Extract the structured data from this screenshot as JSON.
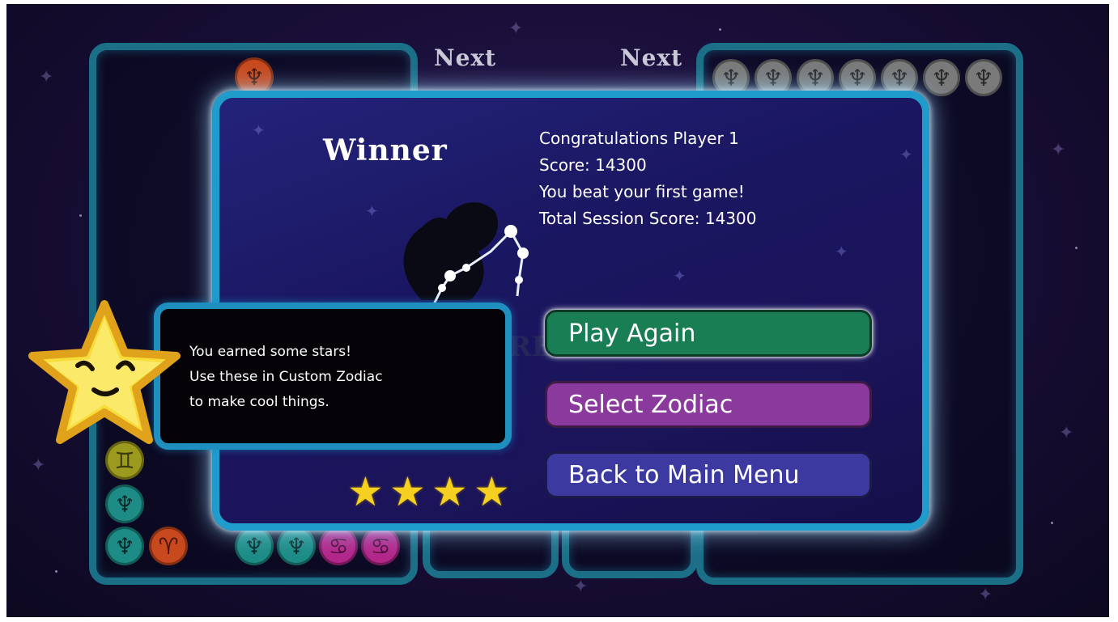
{
  "next_labels": [
    "Next",
    "Next"
  ],
  "dialog": {
    "title": "Winner",
    "lines": [
      "Congratulations Player 1",
      "Score: 14300",
      "You beat your first game!",
      "Total Session Score: 14300"
    ],
    "background_text": "NEW HIGH SCORE!",
    "buttons": {
      "play_again": "Play Again",
      "select_zodiac": "Select Zodiac",
      "main_menu": "Back to Main Menu"
    },
    "stars_earned": 4,
    "accent_color": "#1f9ccc"
  },
  "tooltip": {
    "lines": [
      "You earned some stars!",
      "Use these in Custom Zodiac",
      "to make cool things."
    ]
  },
  "colors": {
    "play_again": "#1a7e55",
    "select_zodiac": "#8a3a9c",
    "main_menu": "#3c3aa0",
    "star": "#f5d020"
  },
  "tokens": {
    "left_board": [
      "aquarius-orange",
      "gemini-olive",
      "pisces-teal",
      "pisces-teal",
      "aries-orange",
      "pisces-teal",
      "pisces-teal",
      "cancer-magenta",
      "cancer-magenta"
    ],
    "right_board": [
      "pisces-gray",
      "pisces-gray",
      "pisces-gray",
      "pisces-gray",
      "pisces-gray",
      "pisces-gray",
      "pisces-gray"
    ]
  }
}
